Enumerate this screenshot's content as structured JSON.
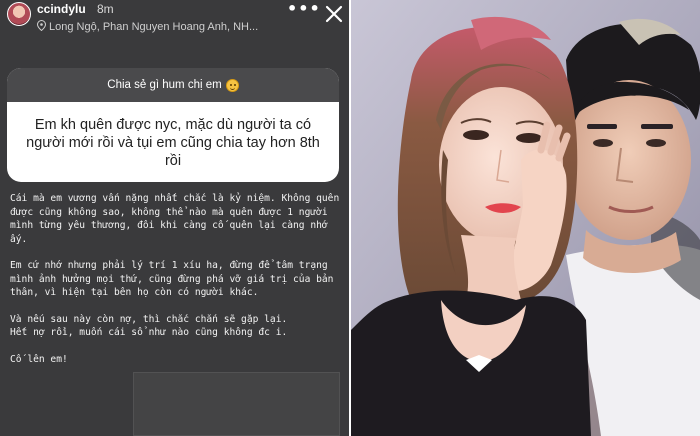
{
  "story": {
    "username": "ccindylu",
    "time": "8m",
    "location": "Long Ngộ, Phan Nguyen Hoang Anh, NH...",
    "more_label": "•••",
    "sticker": {
      "prompt": "Chia sẻ gì hum chị em",
      "emoji": "smiling-face-icon",
      "answer": "Em kh quên được nyc, mặc dù người ta có người mới rồi và tụi em cũng chia tay hơn 8th rồi"
    },
    "reply": {
      "p1": "Cái mà em vương vấn nặng nhất chắc là kỷ niệm. Không quên được cũng không sao, không thể nào mà quên được 1 người mình từng yêu thương, đôi khi càng cố quên lại càng nhớ ấy.",
      "p2": "Em cứ nhớ nhưng phải lý trí 1 xíu ha, đừng để tâm trạng mình ảnh hưởng mọi thứ, cũng đừng phá vỡ giá trị của bản thân, vì hiện tại bên họ còn có người khác.",
      "p3": "Và nếu sau này còn nợ, thì chắc chắn sẽ gặp lại.",
      "p4": "Hết nợ rồi, muốn cái sổ như nào cũng không đc i.",
      "p5": "Cố lên em!"
    }
  },
  "colors": {
    "story_bg": "#3a3a3c",
    "sticker_header": "#4a4a4c",
    "photo_bg": "#b9b6c8"
  }
}
